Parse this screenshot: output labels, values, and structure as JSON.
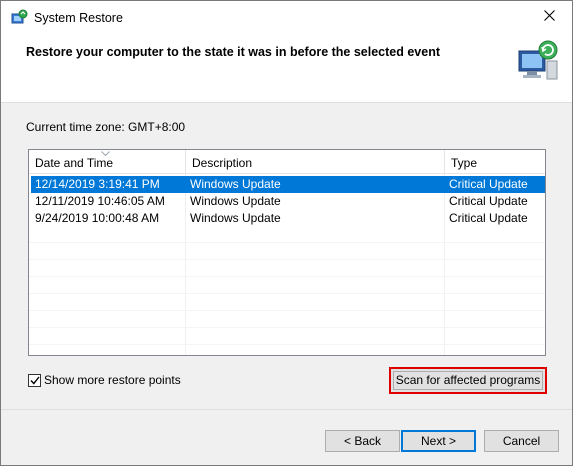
{
  "window": {
    "title": "System Restore",
    "title_icon": "system-restore-icon",
    "close_icon": "close-icon"
  },
  "header": {
    "title": "Restore your computer to the state it was in before the selected event",
    "icon": "restore-computer-icon"
  },
  "timezone_label": "Current time zone: GMT+8:00",
  "table": {
    "columns": [
      "Date and Time",
      "Description",
      "Type"
    ],
    "sorted_column": "Date and Time",
    "rows": [
      {
        "date": "12/14/2019 3:19:41 PM",
        "description": "Windows Update",
        "type": "Critical Update",
        "selected": true
      },
      {
        "date": "12/11/2019 10:46:05 AM",
        "description": "Windows Update",
        "type": "Critical Update",
        "selected": false
      },
      {
        "date": "9/24/2019 10:00:48 AM",
        "description": "Windows Update",
        "type": "Critical Update",
        "selected": false
      }
    ]
  },
  "show_more": {
    "label": "Show more restore points",
    "checked": true
  },
  "scan_button": {
    "label": "Scan for affected programs",
    "highlight_color": "#e00000"
  },
  "footer": {
    "back_label": "< Back",
    "next_label": "Next >",
    "cancel_label": "Cancel"
  },
  "colors": {
    "selection": "#0078d7",
    "accent": "#0078d7"
  }
}
